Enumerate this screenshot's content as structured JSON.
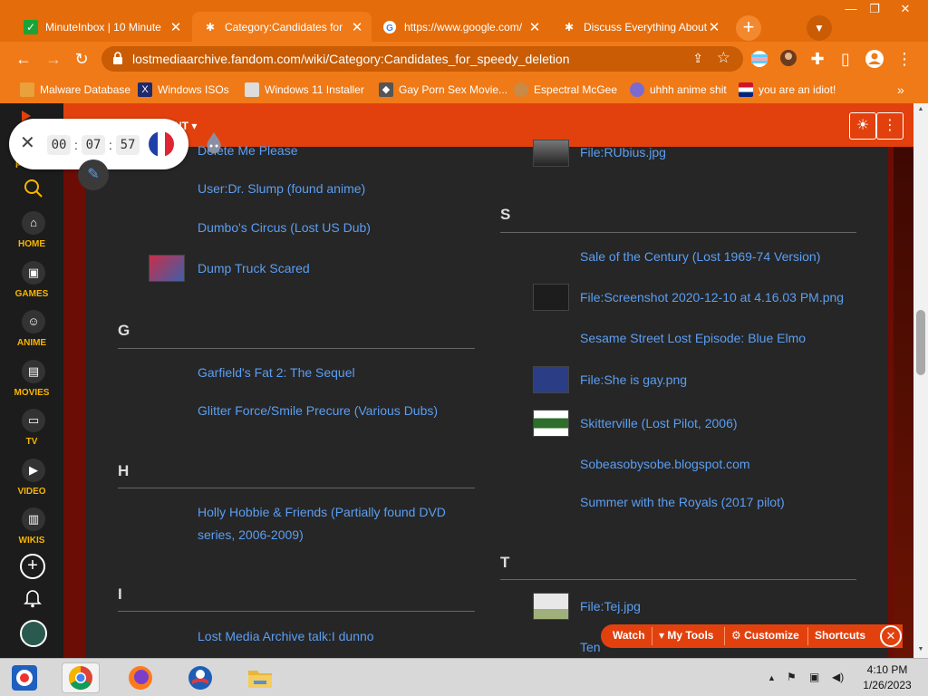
{
  "browser": {
    "tabs": [
      {
        "title": "MinuteInbox | 10 Minute",
        "icon": "minuteinbox-icon"
      },
      {
        "title": "Category:Candidates for",
        "icon": "fandom-icon"
      },
      {
        "title": "https://www.google.com/",
        "icon": "google-icon"
      },
      {
        "title": "Discuss Everything About",
        "icon": "fandom-icon"
      }
    ],
    "tab_close": "✕",
    "new_tab": "+",
    "url": "lostmediaarchive.fandom.com/wiki/Category:Candidates_for_speedy_deletion",
    "bookmarks": [
      {
        "label": "Malware Database",
        "icon": "folder-icon"
      },
      {
        "label": "Windows ISOs",
        "icon": "windows-x-icon"
      },
      {
        "label": "Windows 11 Installer",
        "icon": "installer-icon"
      },
      {
        "label": "Gay Porn Sex Movie...",
        "icon": "bookmark-icon"
      },
      {
        "label": "Espectral McGee",
        "icon": "avatar-icon"
      },
      {
        "label": "uhhh anime shit",
        "icon": "anime-icon"
      },
      {
        "label": "you are an idiot!",
        "icon": "flag-icon"
      }
    ],
    "bookmarks_more": "»",
    "colors": {
      "frame": "#e46c0a",
      "toolbar": "#f07a17",
      "omnibox": "#c95c04"
    }
  },
  "wiki": {
    "menu_partial": "NT",
    "nav": [
      {
        "label": "HOME",
        "icon": "home-icon"
      },
      {
        "label": "GAMES",
        "icon": "gamepad-icon"
      },
      {
        "label": "ANIME",
        "icon": "anime-icon"
      },
      {
        "label": "MOVIES",
        "icon": "clapper-icon"
      },
      {
        "label": "TV",
        "icon": "tv-icon"
      },
      {
        "label": "VIDEO",
        "icon": "video-icon"
      },
      {
        "label": "WIKIS",
        "icon": "book-icon"
      }
    ],
    "nav_partial_label": "F",
    "left_column": [
      {
        "text": "Delete Me Please"
      },
      {
        "text": "User:Dr. Slump (found anime)"
      },
      {
        "text": "Dumbo's Circus (Lost US Dub)"
      },
      {
        "text": "Dump Truck Scared"
      },
      {
        "letter": "G"
      },
      {
        "text": "Garfield's Fat 2: The Sequel"
      },
      {
        "text": "Glitter Force/Smile Precure (Various Dubs)"
      },
      {
        "letter": "H"
      },
      {
        "text": "Holly Hobbie & Friends (Partially found DVD series, 2006-2009)"
      },
      {
        "letter": "I"
      },
      {
        "text": "Lost Media Archive talk:I dunno"
      }
    ],
    "right_column": [
      {
        "text": "File:RUbius.jpg"
      },
      {
        "letter": "S"
      },
      {
        "text": "Sale of the Century (Lost 1969-74 Version)"
      },
      {
        "text": "File:Screenshot 2020-12-10 at 4.16.03 PM.png"
      },
      {
        "text": "Sesame Street Lost Episode: Blue Elmo"
      },
      {
        "text": "File:She is gay.png"
      },
      {
        "text": "Skitterville (Lost Pilot, 2006)"
      },
      {
        "text": "Sobeasobysobe.blogspot.com"
      },
      {
        "text": "Summer with the Royals (2017 pilot)"
      },
      {
        "letter": "T"
      },
      {
        "text": "File:Tej.jpg"
      },
      {
        "text": "Ten"
      }
    ],
    "link_color": "#5b9ef2"
  },
  "timer": {
    "hours": "00",
    "minutes": "07",
    "seconds": "57",
    "flag": "france-flag-icon"
  },
  "mytools": {
    "watch": "Watch",
    "my_tools": "My Tools",
    "customize": "Customize",
    "shortcuts": "Shortcuts"
  },
  "taskbar": {
    "apps": [
      "chromium-icon",
      "chrome-icon",
      "firefox-icon",
      "obama-logo-icon",
      "file-explorer-icon"
    ],
    "time": "4:10 PM",
    "date": "1/26/2023"
  }
}
